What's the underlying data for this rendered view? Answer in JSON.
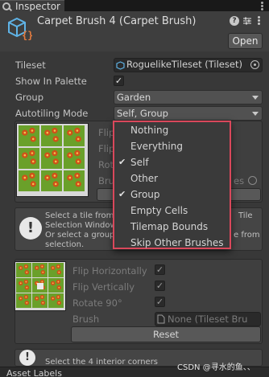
{
  "tab": {
    "label": "Inspector"
  },
  "header": {
    "title": "Carpet Brush 4 (Carpet Brush)",
    "open_label": "Open",
    "help_icon": "?",
    "settings_icon": "sliders-icon",
    "menu_icon": "kebab-icon"
  },
  "fields": {
    "tileset_label": "Tileset",
    "tileset_value": "RoguelikeTileset (Tileset)",
    "show_in_palette_label": "Show In Palette",
    "show_in_palette_checked": true,
    "group_label": "Group",
    "group_value": "Garden",
    "autotiling_label": "Autotiling Mode",
    "autotiling_value": "Self, Group"
  },
  "rule1": {
    "flip_h_partial": "Flip",
    "flip_v_partial": "Flip",
    "rotate_partial": "Rota",
    "brush_partial": "Brus",
    "brush_value_tail": "es"
  },
  "help1": {
    "line1_left": "Select  a  tile from",
    "line1_right": "Tile",
    "line2": "Selection Window",
    "line3_left": "Or select a group",
    "line3_right": "e from",
    "line4": "selection."
  },
  "rule2": {
    "flip_h_label": "Flip Horizontally",
    "flip_v_label": "Flip Vertically",
    "rotate_label": "Rotate 90°",
    "brush_label": "Brush",
    "brush_value": "None (Tileset Bru",
    "reset_label": "Reset"
  },
  "help2": {
    "text": "Select the 4 interior corners"
  },
  "dropdown_options": [
    {
      "label": "Nothing",
      "checked": false
    },
    {
      "label": "Everything",
      "checked": false
    },
    {
      "label": "Self",
      "checked": true
    },
    {
      "label": "Other",
      "checked": false
    },
    {
      "label": "Group",
      "checked": true
    },
    {
      "label": "Empty Cells",
      "checked": false
    },
    {
      "label": "Tilemap Bounds",
      "checked": false
    },
    {
      "label": "Skip Other Brushes",
      "checked": false
    }
  ],
  "footer": {
    "title": "Asset Labels"
  },
  "watermark": "CSDN @寻水的鱼、、",
  "colors": {
    "highlight_border": "#d9485b",
    "grass": "#6aa02a",
    "flower": "#d05018",
    "panel_bg": "#383838"
  }
}
